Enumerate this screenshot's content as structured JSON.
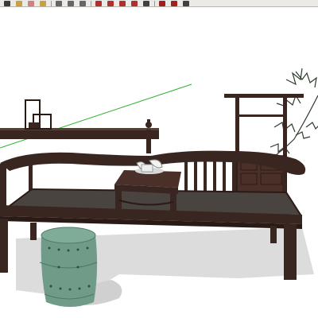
{
  "app": {
    "viewport_label": ""
  },
  "toolbar": {
    "tools": [
      {
        "name": "select-tool",
        "icon": "arrow-icon",
        "color": "#3a3a3a"
      },
      {
        "name": "paint-tool",
        "icon": "bucket-icon",
        "color": "#c8a040"
      },
      {
        "name": "eraser-tool",
        "icon": "eraser-icon",
        "color": "#d08080"
      },
      {
        "name": "line-tool",
        "icon": "pencil-icon",
        "color": "#c8a040"
      },
      {
        "name": "rectangle-tool",
        "icon": "rectangle-icon",
        "color": "#666666"
      },
      {
        "name": "circle-tool",
        "icon": "circle-icon",
        "color": "#666666"
      },
      {
        "name": "arc-tool",
        "icon": "arc-icon",
        "color": "#666666"
      },
      {
        "name": "move-tool",
        "icon": "move-icon",
        "color": "#b03030"
      },
      {
        "name": "pushpull-tool",
        "icon": "pushpull-icon",
        "color": "#b03030"
      },
      {
        "name": "rotate-tool",
        "icon": "rotate-icon",
        "color": "#b03030"
      },
      {
        "name": "offset-tool",
        "icon": "offset-icon",
        "color": "#b03030"
      },
      {
        "name": "tape-measure-tool",
        "icon": "tape-icon",
        "color": "#404040"
      },
      {
        "name": "orbit-tool",
        "icon": "orbit-icon",
        "color": "#a02020"
      },
      {
        "name": "pan-tool",
        "icon": "pan-icon",
        "color": "#a02020"
      },
      {
        "name": "zoom-tool",
        "icon": "zoom-icon",
        "color": "#404040"
      }
    ]
  },
  "scene": {
    "model_name": "",
    "colors": {
      "wood": "#3a2620",
      "wood_dark": "#2a1a16",
      "seat_panel": "#4a4440",
      "shadow": "#d9d9d9",
      "stool": "#6f9b88",
      "stool_dark": "#4d7a69",
      "axis_green": "#2cb02c",
      "pine": "#2d3a2d"
    }
  }
}
